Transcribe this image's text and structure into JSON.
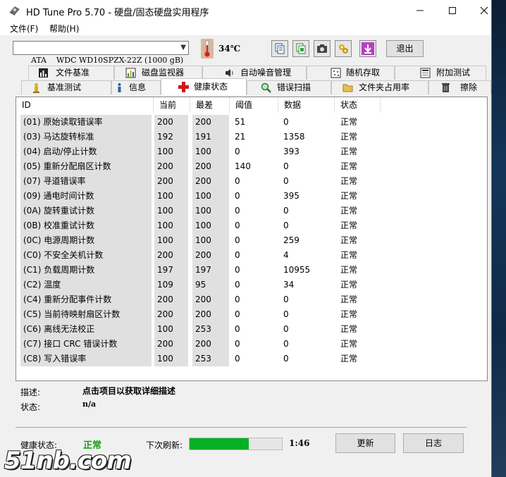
{
  "window": {
    "title": "HD Tune Pro 5.70 - 硬盘/固态硬盘实用程序"
  },
  "menu": [
    {
      "label": "文件(F)"
    },
    {
      "label": "帮助(H)"
    }
  ],
  "toolbar": {
    "drive": "ATA    WDC WD10SPZX-22Z (1000 gB)",
    "temperature": "34℃",
    "exit_label": "退出",
    "icons": [
      "copy-icon",
      "copy-all-icon",
      "camera-icon",
      "options-icon",
      "save-icon"
    ]
  },
  "tabs": {
    "row1": [
      {
        "label": "文件基准",
        "icon": "file-benchmark-icon"
      },
      {
        "label": "磁盘监视器",
        "icon": "disk-monitor-icon"
      },
      {
        "label": "自动噪音管理",
        "icon": "speaker-icon"
      },
      {
        "label": "随机存取",
        "icon": "random-access-icon"
      },
      {
        "label": "附加测试",
        "icon": "extra-tests-icon"
      }
    ],
    "row2": [
      {
        "label": "基准测试",
        "icon": "benchmark-icon"
      },
      {
        "label": "信息",
        "icon": "info-icon"
      },
      {
        "label": "健康状态",
        "icon": "health-cross-icon"
      },
      {
        "label": "错误扫描",
        "icon": "magnifier-icon"
      },
      {
        "label": "文件夹占用率",
        "icon": "folder-icon"
      },
      {
        "label": "擦除",
        "icon": "trash-icon"
      }
    ],
    "active": "健康状态"
  },
  "table": {
    "headers": [
      "ID",
      "当前",
      "最差",
      "阈值",
      "数据",
      "状态"
    ],
    "rows": [
      [
        "(01) 原始读取错误率",
        "200",
        "200",
        "51",
        "0",
        "正常"
      ],
      [
        "(03) 马达旋转标准",
        "192",
        "191",
        "21",
        "1358",
        "正常"
      ],
      [
        "(04) 启动/停止计数",
        "100",
        "100",
        "0",
        "393",
        "正常"
      ],
      [
        "(05) 重新分配扇区计数",
        "200",
        "200",
        "140",
        "0",
        "正常"
      ],
      [
        "(07) 寻道错误率",
        "200",
        "200",
        "0",
        "0",
        "正常"
      ],
      [
        "(09) 通电时间计数",
        "100",
        "100",
        "0",
        "395",
        "正常"
      ],
      [
        "(0A) 旋转重试计数",
        "100",
        "100",
        "0",
        "0",
        "正常"
      ],
      [
        "(0B) 校准重试计数",
        "100",
        "100",
        "0",
        "0",
        "正常"
      ],
      [
        "(0C) 电源周期计数",
        "100",
        "100",
        "0",
        "259",
        "正常"
      ],
      [
        "(C0) 不安全关机计数",
        "200",
        "200",
        "0",
        "4",
        "正常"
      ],
      [
        "(C1) 负载周期计数",
        "197",
        "197",
        "0",
        "10955",
        "正常"
      ],
      [
        "(C2) 温度",
        "109",
        "95",
        "0",
        "34",
        "正常"
      ],
      [
        "(C4) 重新分配事件计数",
        "200",
        "200",
        "0",
        "0",
        "正常"
      ],
      [
        "(C5) 当前待映射扇区计数",
        "200",
        "200",
        "0",
        "0",
        "正常"
      ],
      [
        "(C6) 离线无法校正",
        "100",
        "253",
        "0",
        "0",
        "正常"
      ],
      [
        "(C7) 接口 CRC 错误计数",
        "200",
        "200",
        "0",
        "0",
        "正常"
      ],
      [
        "(C8) 写入错误率",
        "100",
        "253",
        "0",
        "0",
        "正常"
      ]
    ]
  },
  "details": {
    "desc_label": "描述:",
    "desc_value": "点击项目以获取详细描述",
    "status_label": "状态:",
    "status_value": "n/a"
  },
  "footer": {
    "health_label": "健康状态:",
    "health_value": "正常",
    "health_color": "#15a015",
    "refresh_label": "下次刷新:",
    "refresh_progress": 0.64,
    "countdown": "1:46",
    "refresh_button": "更新",
    "log_button": "日志"
  },
  "watermark": "51nb.com"
}
